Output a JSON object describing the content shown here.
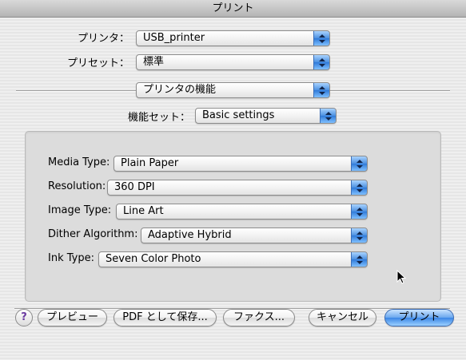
{
  "window": {
    "title": "プリント"
  },
  "printer": {
    "label": "プリンタ：",
    "value": "USB_printer"
  },
  "preset": {
    "label": "プリセット：",
    "value": "標準"
  },
  "panel": {
    "value": "プリンタの機能"
  },
  "feature_set": {
    "label": "機能セット：",
    "value": "Basic settings"
  },
  "settings": [
    {
      "label": "Media Type:",
      "value": "Plain Paper"
    },
    {
      "label": "Resolution:",
      "value": "360 DPI"
    },
    {
      "label": "Image Type:",
      "value": "Line Art"
    },
    {
      "label": "Dither Algorithm:",
      "value": "Adaptive Hybrid"
    },
    {
      "label": "Ink Type:",
      "value": "Seven Color Photo"
    }
  ],
  "buttons": {
    "help": "?",
    "preview": "プレビュー",
    "pdf": "PDF として保存...",
    "fax": "ファクス...",
    "cancel": "キャンセル",
    "print": "プリント"
  },
  "colors": {
    "accent": "#3b86e6"
  }
}
